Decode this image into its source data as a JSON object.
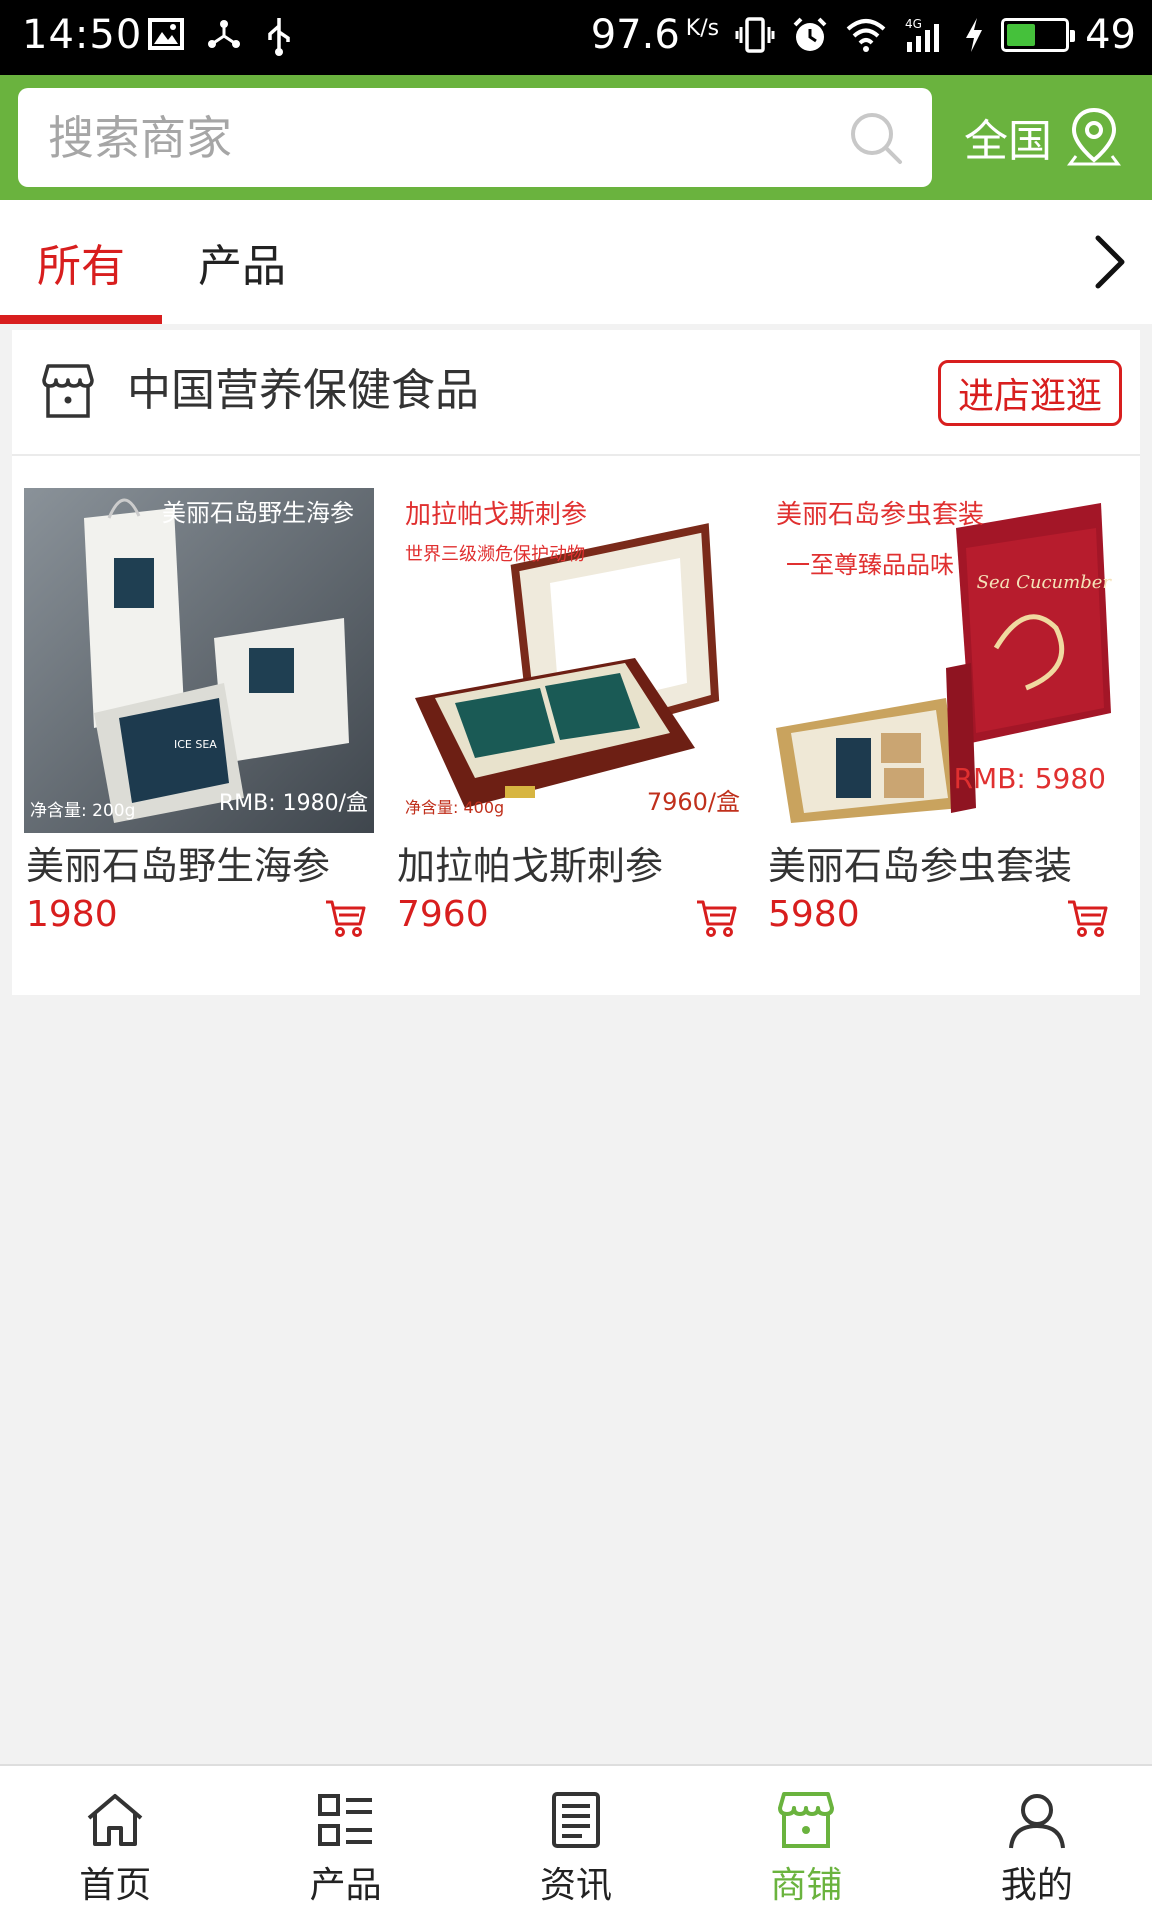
{
  "status_bar": {
    "time": "14:50",
    "speed": "97.6",
    "speed_unit": "K/s",
    "battery": "49",
    "battery_level": 0.49,
    "battery_color": "#45c13b"
  },
  "header": {
    "search_placeholder": "搜索商家",
    "region_label": "全国",
    "accent_color": "#6ab33e"
  },
  "tabs": [
    {
      "label": "所有",
      "active": true
    },
    {
      "label": "产品",
      "active": false
    }
  ],
  "shop": {
    "name": "中国营养保健食品",
    "enter_label": "进店逛逛",
    "products": [
      {
        "name": "美丽石岛野生海参",
        "price": "1980",
        "image_caption": "美丽石岛野生海参",
        "image_weight": "净含量: 200g",
        "image_price": "RMB: 1980/盒",
        "brand_text": "ICE SEA"
      },
      {
        "name": "加拉帕戈斯刺参",
        "price": "7960",
        "image_caption": "加拉帕戈斯刺参",
        "image_subcaption": "世界三级濒危保护动物",
        "image_weight": "净含量: 400g",
        "image_price": "7960/盒"
      },
      {
        "name": "美丽石岛参虫套装",
        "price": "5980",
        "image_caption": "美丽石岛参虫套装",
        "image_subcaption": "一至尊臻品品味",
        "image_price": "RMB: 5980",
        "brand_text": "Sea Cucumber"
      }
    ]
  },
  "bottom_nav": [
    {
      "label": "首页",
      "icon": "home-icon",
      "active": false
    },
    {
      "label": "产品",
      "icon": "grid-list-icon",
      "active": false
    },
    {
      "label": "资讯",
      "icon": "document-icon",
      "active": false
    },
    {
      "label": "商铺",
      "icon": "store-icon",
      "active": true
    },
    {
      "label": "我的",
      "icon": "user-icon",
      "active": false
    }
  ],
  "colors": {
    "highlight": "#d81e1e",
    "page_background": "#f2f2f2"
  }
}
